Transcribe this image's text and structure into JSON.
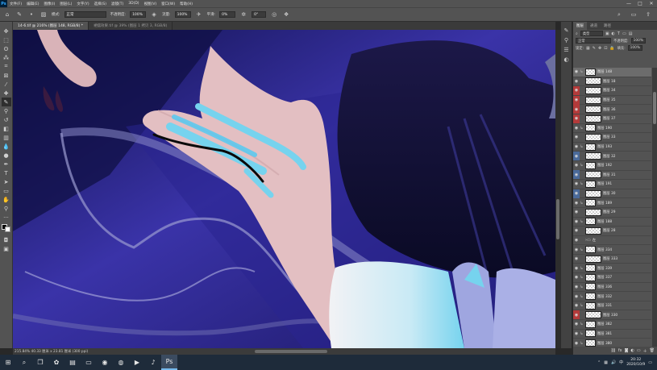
{
  "menubar": {
    "logo": "Ps",
    "items": [
      "文件(F)",
      "编辑(E)",
      "图像(I)",
      "图层(L)",
      "文字(Y)",
      "选择(S)",
      "滤镜(T)",
      "3D(D)",
      "视图(V)",
      "窗口(W)",
      "帮助(H)"
    ],
    "window_controls": [
      "—",
      "□",
      "✕"
    ]
  },
  "options": {
    "mode_label": "模式:",
    "mode_value": "正常",
    "opacity_label": "不透明度:",
    "opacity_value": "100%",
    "flow_label": "流量:",
    "flow_value": "100%",
    "smooth_label": "平滑:",
    "smooth_value": "0%",
    "angle_value": "0°"
  },
  "tabs": [
    {
      "label": "14-6.tif @ 216% (图层 148, RGB/8) *"
    },
    {
      "label": "裙摆效果.tif @ 39% (图层 1 拷贝 3, RGB/8)"
    }
  ],
  "status": {
    "text": "215.84%   40.33 厘米 x 23.81 厘米 (300 ppi)"
  },
  "panel": {
    "tabs": [
      "图层",
      "通道",
      "路径"
    ],
    "filter_label": "类型",
    "blend_mode": "正常",
    "opacity_label": "不透明度:",
    "opacity_value": "100%",
    "lock_label": "锁定:",
    "fill_label": "填充:",
    "fill_value": "100%"
  },
  "layers": [
    {
      "name": "图层 148",
      "eye": "normal",
      "clip": true,
      "selected": true
    },
    {
      "name": "图层 18",
      "eye": "normal",
      "clip": false
    },
    {
      "name": "图层 34",
      "eye": "red",
      "clip": false
    },
    {
      "name": "图层 35",
      "eye": "red",
      "clip": false
    },
    {
      "name": "图层 36",
      "eye": "red",
      "clip": false
    },
    {
      "name": "图层 37",
      "eye": "red",
      "clip": false
    },
    {
      "name": "图层 190",
      "eye": "normal",
      "clip": true
    },
    {
      "name": "图层 33",
      "eye": "normal",
      "clip": false
    },
    {
      "name": "图层 193",
      "eye": "normal",
      "clip": true
    },
    {
      "name": "图层 32",
      "eye": "blue",
      "clip": false
    },
    {
      "name": "图层 192",
      "eye": "normal",
      "clip": true
    },
    {
      "name": "图层 31",
      "eye": "blue",
      "clip": false
    },
    {
      "name": "图层 191",
      "eye": "normal",
      "clip": true
    },
    {
      "name": "图层 30",
      "eye": "blue",
      "clip": false
    },
    {
      "name": "图层 189",
      "eye": "normal",
      "clip": true
    },
    {
      "name": "图层 29",
      "eye": "normal",
      "clip": false
    },
    {
      "name": "图层 188",
      "eye": "normal",
      "clip": true
    },
    {
      "name": "图层 28",
      "eye": "normal",
      "clip": false
    },
    {
      "name": "左",
      "eye": "normal",
      "clip": false,
      "folder": true
    },
    {
      "name": "图层 334",
      "eye": "normal",
      "clip": true
    },
    {
      "name": "图层 333",
      "eye": "normal",
      "clip": false
    },
    {
      "name": "图层 339",
      "eye": "normal",
      "clip": true
    },
    {
      "name": "图层 337",
      "eye": "normal",
      "clip": true
    },
    {
      "name": "图层 336",
      "eye": "normal",
      "clip": true
    },
    {
      "name": "图层 332",
      "eye": "normal",
      "clip": true
    },
    {
      "name": "图层 331",
      "eye": "normal",
      "clip": true
    },
    {
      "name": "图层 330",
      "eye": "red",
      "clip": false
    },
    {
      "name": "图层 382",
      "eye": "normal",
      "clip": true
    },
    {
      "name": "图层 381",
      "eye": "normal",
      "clip": true
    },
    {
      "name": "图层 380",
      "eye": "normal",
      "clip": true
    }
  ],
  "taskbar": {
    "apps": [
      {
        "icon": "windows-start-icon",
        "glyph": "⊞"
      },
      {
        "icon": "search-icon",
        "glyph": "⌕"
      },
      {
        "icon": "task-view-icon",
        "glyph": "❐"
      },
      {
        "icon": "store-icon",
        "glyph": "✿"
      },
      {
        "icon": "file-explorer-icon",
        "glyph": "▤"
      },
      {
        "icon": "explorer-folder-icon",
        "glyph": "▭"
      },
      {
        "icon": "wechat-icon",
        "glyph": "◉"
      },
      {
        "icon": "chrome-icon",
        "glyph": "◍"
      },
      {
        "icon": "media-player-icon",
        "glyph": "▶"
      },
      {
        "icon": "music-icon",
        "glyph": "♪"
      },
      {
        "icon": "photoshop-icon",
        "glyph": "Ps",
        "active": true
      }
    ],
    "time": "20:32",
    "date": "2020/10/9"
  }
}
